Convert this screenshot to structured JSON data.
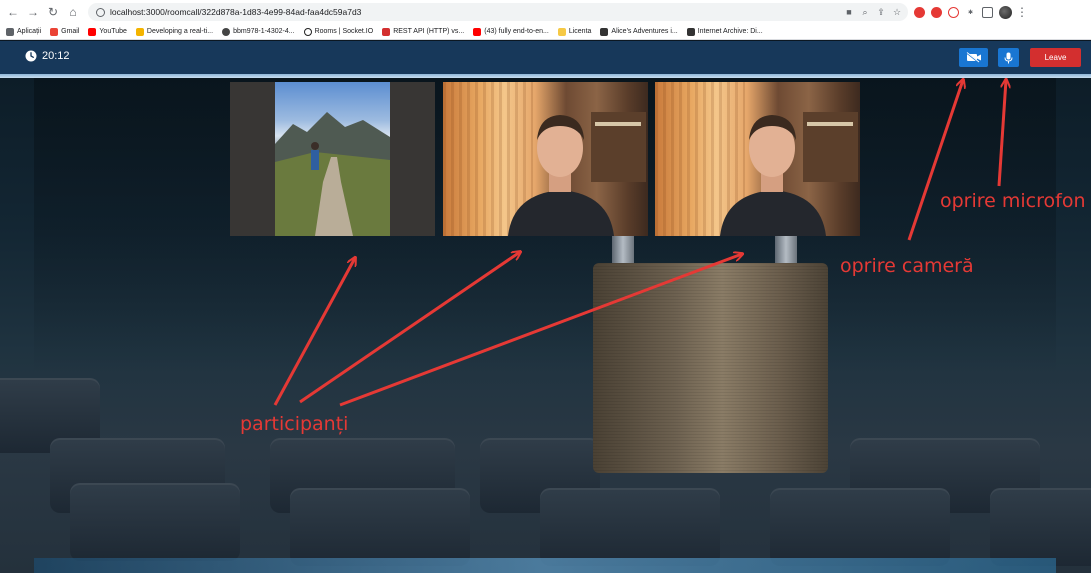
{
  "browser": {
    "url": "localhost:3000/roomcall/322d878a-1d83-4e99-84ad-faa4dc59a7d3",
    "bookmarks": [
      {
        "label": "Aplicații",
        "color": "#5f6368"
      },
      {
        "label": "Gmail",
        "color": "#ea4335"
      },
      {
        "label": "YouTube",
        "color": "#ff0000"
      },
      {
        "label": "Developing a real-ti...",
        "color": "#f4b400"
      },
      {
        "label": "bbm978-1-4302-4...",
        "color": "#444444"
      },
      {
        "label": "Rooms | Socket.IO",
        "color": "#222222"
      },
      {
        "label": "REST API (HTTP) vs...",
        "color": "#d32f2f"
      },
      {
        "label": "(43) fully end-to-en...",
        "color": "#ff0000"
      },
      {
        "label": "Licenta",
        "color": "#f6c945"
      },
      {
        "label": "Alice's Adventures i...",
        "color": "#333333"
      },
      {
        "label": "Internet Archive: Di...",
        "color": "#333333"
      }
    ]
  },
  "header": {
    "timer": "20:12",
    "leave_label": "Leave"
  },
  "colors": {
    "header_bg": "#17385a",
    "button_blue": "#1976d2",
    "leave_red": "#d32f2f",
    "annotation_red": "#e53935"
  },
  "annotations": {
    "participants": "participanți",
    "camera_off": "oprire cameră",
    "mic_off": "oprire microfon"
  }
}
